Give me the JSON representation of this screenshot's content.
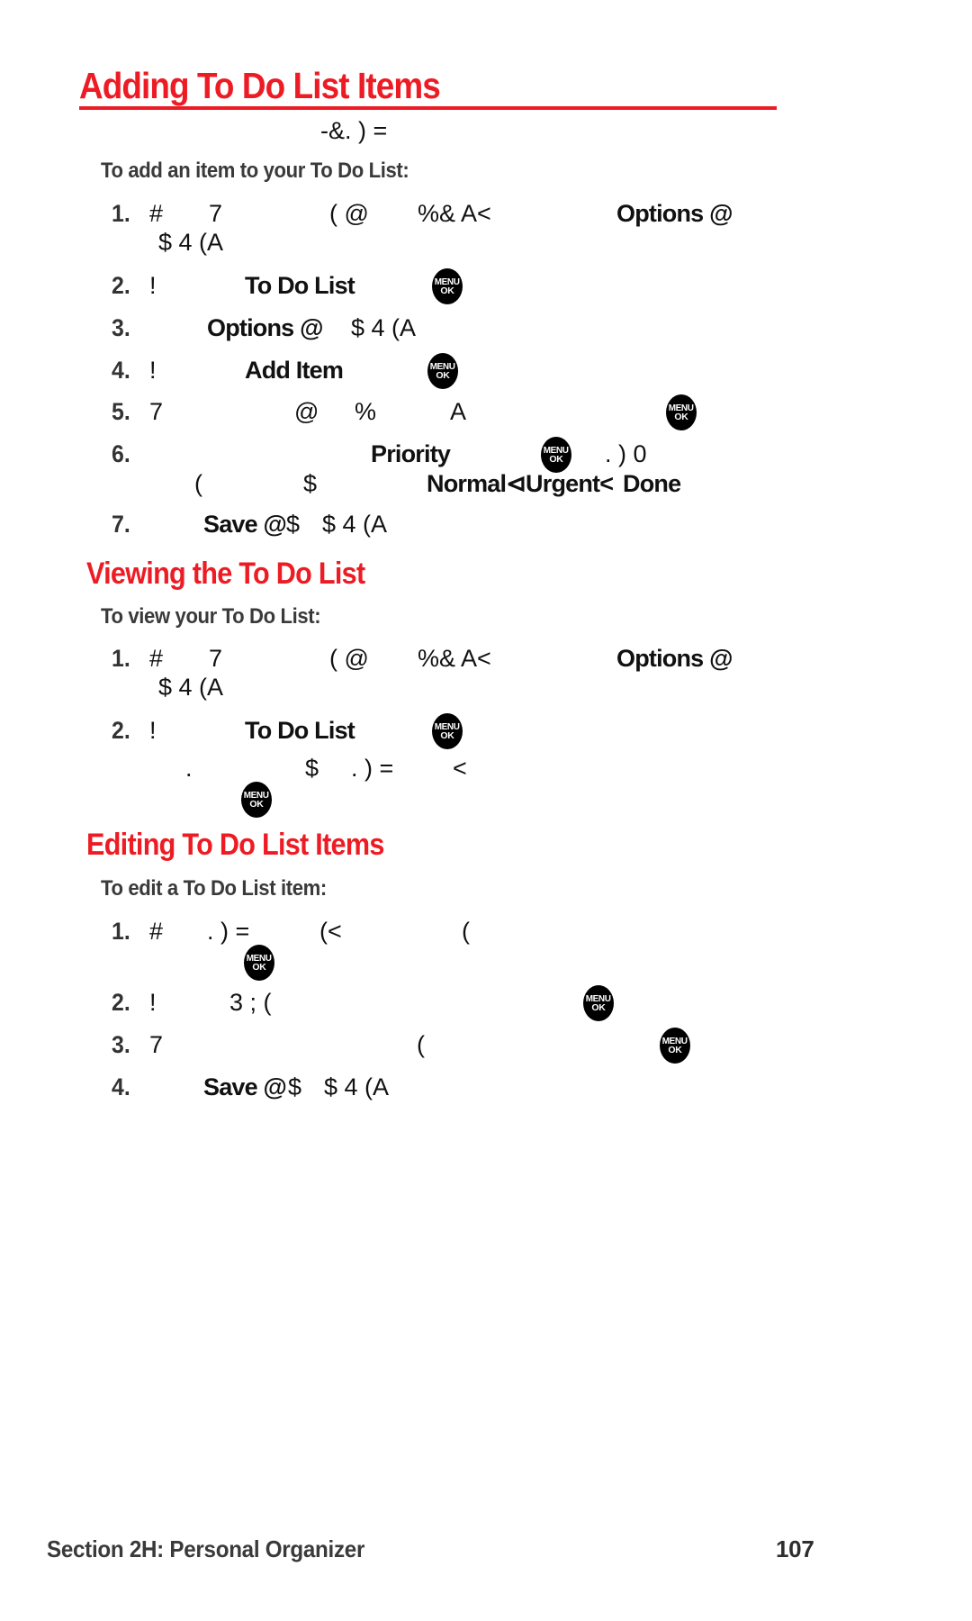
{
  "document": {
    "type": "phone-user-manual-page",
    "accent_color": "#ED1C24",
    "text_color": "#111111",
    "background": "#FFFFFF"
  },
  "sections": [
    {
      "heading": "Adding To Do List Items",
      "lead": "-&. ) =",
      "intro": "To add an item to your To Do List:",
      "steps": [
        {
          "num": "1.",
          "line1_a": "#",
          "line1_b": "7",
          "line1_c": "( @",
          "line1_d": "%& A<",
          "line1_e": "Options @",
          "line2": "$ 4 (A"
        },
        {
          "num": "2.",
          "a": "!",
          "b": "To Do List",
          "key": "MENU OK"
        },
        {
          "num": "3.",
          "a": "Options @",
          "b": "$ 4 (A"
        },
        {
          "num": "4.",
          "a": "!",
          "b": "Add Item",
          "key": "MENU OK"
        },
        {
          "num": "5.",
          "a": "7",
          "b": "@",
          "c": "%",
          "d": "A",
          "key": "MENU OK"
        },
        {
          "num": "6.",
          "a": "Priority",
          "key": "MENU OK",
          "b": ". ) 0",
          "line2_a": "(",
          "line2_b": "$",
          "line2_c": "Normal⊲Urgent<",
          "line2_d": "Done"
        },
        {
          "num": "7.",
          "a": "Save @",
          "b": "$",
          "c": "$ 4 (A"
        }
      ]
    },
    {
      "heading": "Viewing the To Do List",
      "intro": "To view your To Do List:",
      "steps": [
        {
          "num": "1.",
          "line1_a": "#",
          "line1_b": "7",
          "line1_c": "( @",
          "line1_d": "%& A<",
          "line1_e": "Options @",
          "line2": "$ 4 (A"
        },
        {
          "num": "2.",
          "a": "!",
          "b": "To Do List",
          "key": "MENU OK",
          "line2_a": ".",
          "line2_b": "$",
          "line2_c": ". ) =",
          "line2_d": "<",
          "key2": "MENU OK"
        }
      ]
    },
    {
      "heading": "Editing To Do List Items",
      "intro": "To edit a To Do List item:",
      "steps": [
        {
          "num": "1.",
          "a": "#",
          "b": ". ) =",
          "c": "(<",
          "d": "(",
          "key": "MENU OK"
        },
        {
          "num": "2.",
          "a": "!",
          "b": "3 ; (",
          "key": "MENU OK"
        },
        {
          "num": "3.",
          "a": "7",
          "b": "(",
          "key": "MENU OK"
        },
        {
          "num": "4.",
          "a": "Save @",
          "b": "$",
          "c": "$ 4 (A"
        }
      ]
    }
  ],
  "key_glyph": {
    "line1": "MENU",
    "line2": "OK"
  },
  "footer": {
    "left": "Section 2H: Personal Organizer",
    "page_number": "107"
  }
}
